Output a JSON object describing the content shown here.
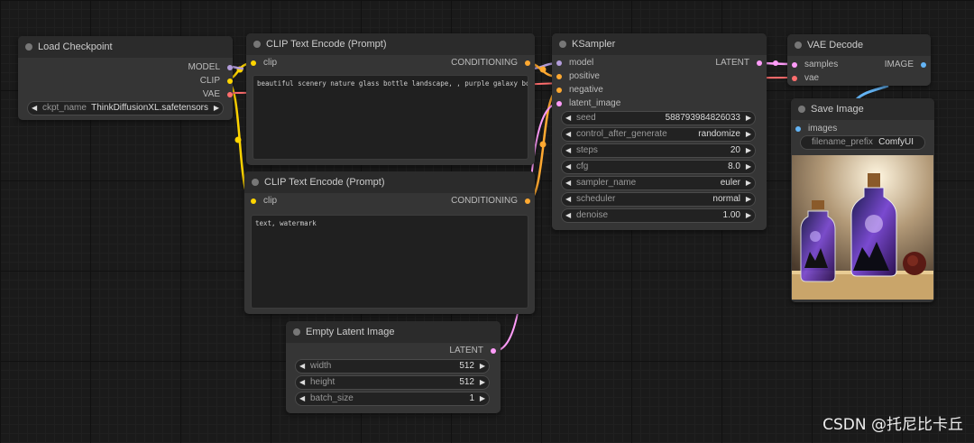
{
  "colors": {
    "model": "#b39ddb",
    "clip": "#ffd500",
    "vae": "#ff6e6e",
    "conditioning": "#ffa931",
    "latent": "#ff9cf9",
    "image": "#64b5f6"
  },
  "load_checkpoint": {
    "title": "Load Checkpoint",
    "outputs": {
      "model": "MODEL",
      "clip": "CLIP",
      "vae": "VAE"
    },
    "ckpt_name": {
      "label": "ckpt_name",
      "value": "ThinkDiffusionXL.safetensors"
    }
  },
  "clip_positive": {
    "title": "CLIP Text Encode (Prompt)",
    "input": "clip",
    "output": "CONDITIONING",
    "text": "beautiful scenery nature glass bottle landscape, , purple galaxy bottle,"
  },
  "clip_negative": {
    "title": "CLIP Text Encode (Prompt)",
    "input": "clip",
    "output": "CONDITIONING",
    "text": "text, watermark"
  },
  "ksampler": {
    "title": "KSampler",
    "inputs": {
      "model": "model",
      "positive": "positive",
      "negative": "negative",
      "latent_image": "latent_image"
    },
    "output": "LATENT",
    "widgets": [
      {
        "label": "seed",
        "value": "588793984826033"
      },
      {
        "label": "control_after_generate",
        "value": "randomize"
      },
      {
        "label": "steps",
        "value": "20"
      },
      {
        "label": "cfg",
        "value": "8.0"
      },
      {
        "label": "sampler_name",
        "value": "euler"
      },
      {
        "label": "scheduler",
        "value": "normal"
      },
      {
        "label": "denoise",
        "value": "1.00"
      }
    ]
  },
  "vae_decode": {
    "title": "VAE Decode",
    "inputs": {
      "samples": "samples",
      "vae": "vae"
    },
    "output": "IMAGE"
  },
  "save_image": {
    "title": "Save Image",
    "input": "images",
    "filename_prefix": {
      "label": "filename_prefix",
      "value": "ComfyUI"
    }
  },
  "empty_latent": {
    "title": "Empty Latent Image",
    "output": "LATENT",
    "widgets": [
      {
        "label": "width",
        "value": "512"
      },
      {
        "label": "height",
        "value": "512"
      },
      {
        "label": "batch_size",
        "value": "1"
      }
    ]
  },
  "watermark": "CSDN @托尼比卡丘"
}
